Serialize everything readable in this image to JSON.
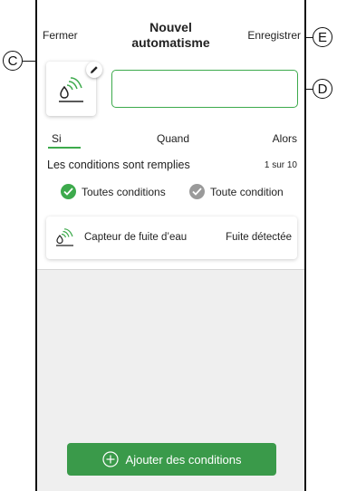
{
  "header": {
    "close_label": "Fermer",
    "title_line1": "Nouvel",
    "title_line2": "automatisme",
    "save_label": "Enregistrer"
  },
  "automation": {
    "icon": "water-leak-icon",
    "name_value": ""
  },
  "tabs": [
    {
      "label": "Si",
      "active": true
    },
    {
      "label": "Quand",
      "active": false
    },
    {
      "label": "Alors",
      "active": false
    }
  ],
  "conditions": {
    "label": "Les conditions sont remplies",
    "count": "1 sur 10",
    "options": [
      {
        "label": "Toutes conditions",
        "selected": true
      },
      {
        "label": "Toute condition",
        "selected": false
      }
    ],
    "items": [
      {
        "icon": "water-leak-icon",
        "label": "Capteur de fuite d’eau",
        "status": "Fuite détectée"
      }
    ]
  },
  "add_button": {
    "label": "Ajouter des conditions"
  },
  "callouts": {
    "c": "C",
    "d": "D",
    "e": "E"
  },
  "colors": {
    "accent": "#3daa4c",
    "button": "#3a9a4a",
    "inactive": "#9a9a9a",
    "background_grey": "#efefef"
  }
}
